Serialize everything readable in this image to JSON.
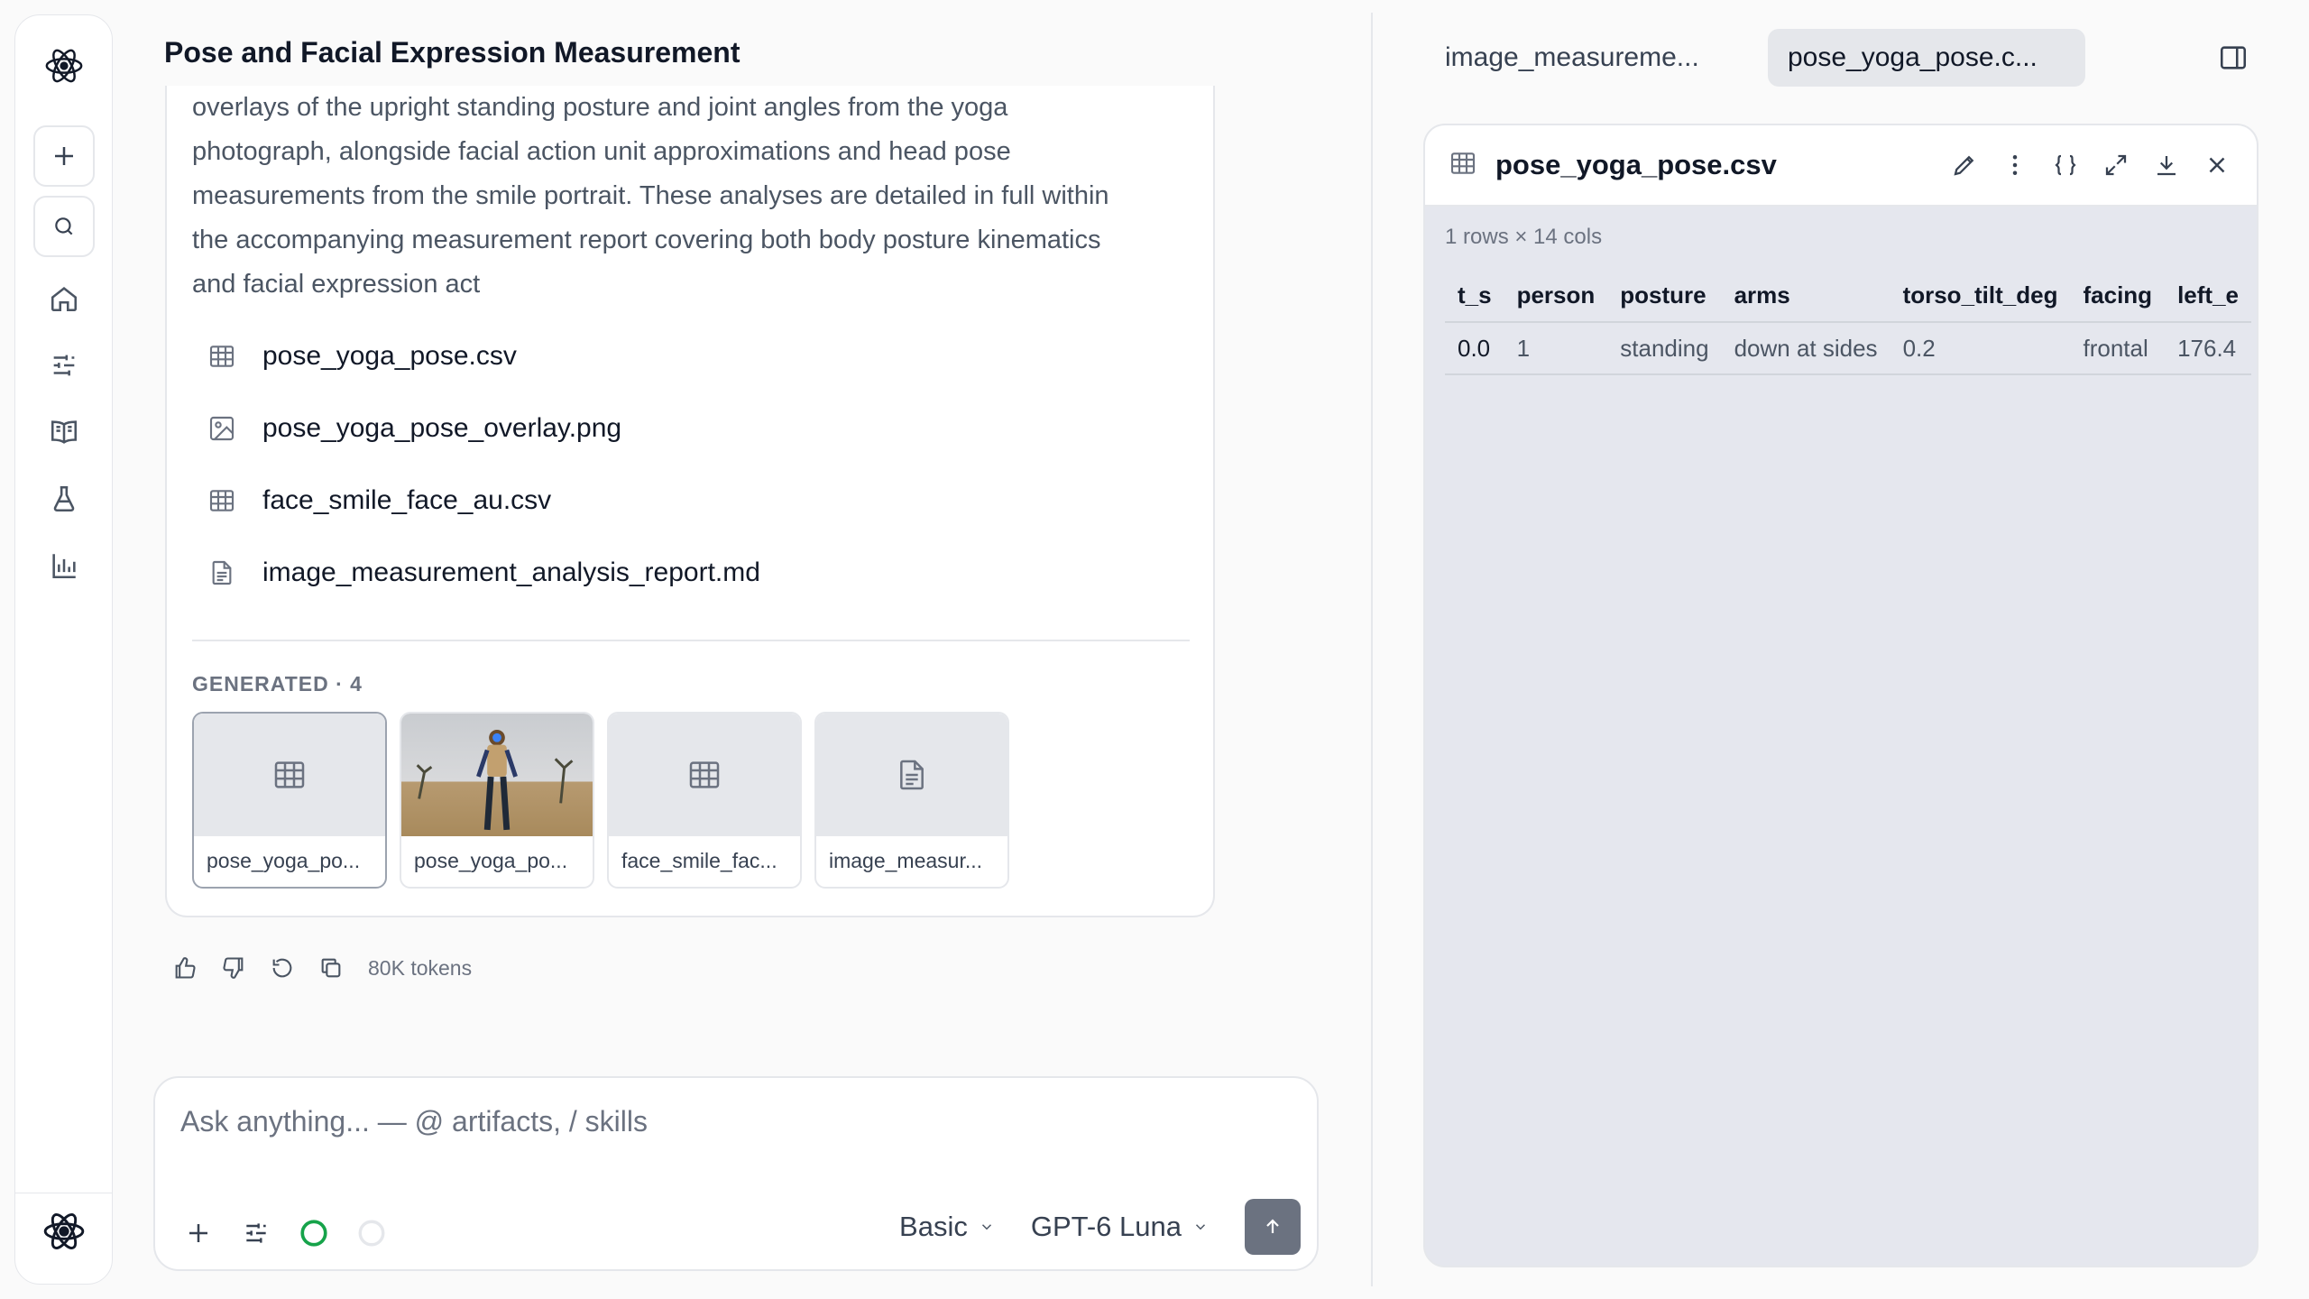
{
  "chat": {
    "title": "Pose and Facial Expression Measurement",
    "message_lines": [
      "overlays of the upright standing posture and joint angles from the yoga",
      "photograph, alongside facial action unit approximations and head pose",
      "measurements from the smile portrait. These analyses are detailed in full within",
      "the accompanying measurement report covering both body posture kinematics",
      "and facial expression act"
    ],
    "files": [
      {
        "name": "pose_yoga_pose.csv",
        "icon": "table-icon"
      },
      {
        "name": "pose_yoga_pose_overlay.png",
        "icon": "image-icon"
      },
      {
        "name": "face_smile_face_au.csv",
        "icon": "table-icon"
      },
      {
        "name": "image_measurement_analysis_report.md",
        "icon": "document-icon"
      }
    ],
    "generated_label": "GENERATED · 4",
    "thumbnails": [
      {
        "caption": "pose_yoga_po...",
        "icon": "table-icon"
      },
      {
        "caption": "pose_yoga_po...",
        "icon": "image-preview"
      },
      {
        "caption": "face_smile_fac...",
        "icon": "table-icon"
      },
      {
        "caption": "image_measur...",
        "icon": "document-icon"
      }
    ],
    "tokens": "80K tokens"
  },
  "composer": {
    "placeholder": "Ask anything... — @ artifacts, / skills",
    "mode": "Basic",
    "model": "GPT-6 Luna"
  },
  "viewer": {
    "tabs": [
      "image_measureme...",
      "pose_yoga_pose.c..."
    ],
    "active_tab": 1,
    "file_title": "pose_yoga_pose.csv",
    "meta": "1 rows × 14 cols",
    "columns": [
      "t_s",
      "person",
      "posture",
      "arms",
      "torso_tilt_deg",
      "facing",
      "left_e"
    ],
    "rows": [
      [
        "0.0",
        "1",
        "standing",
        "down at sides",
        "0.2",
        "frontal",
        "176.4"
      ]
    ]
  },
  "colors": {
    "accent_green": "#16a34a",
    "send_button": "#6b7280",
    "panel_bg": "#e5e7ee"
  }
}
